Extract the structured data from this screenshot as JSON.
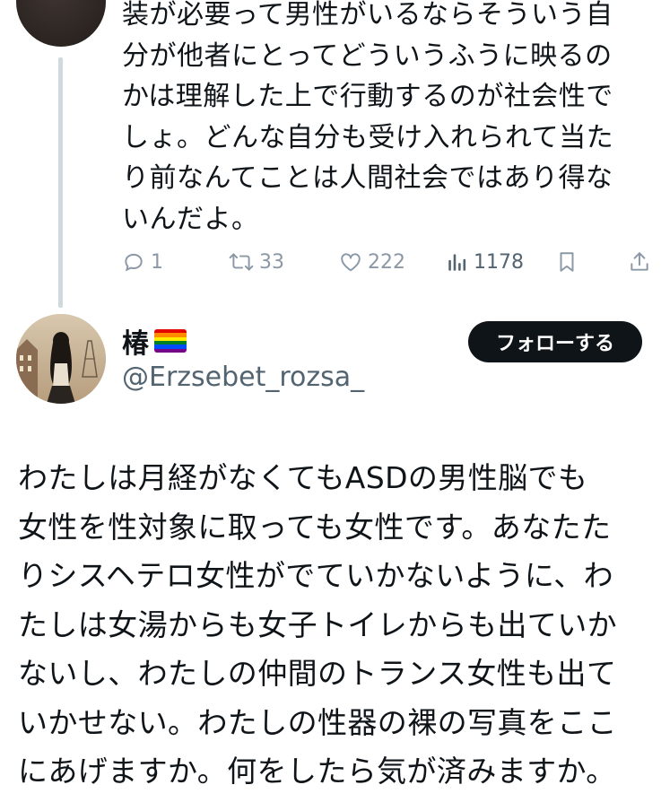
{
  "parent_tweet": {
    "lines": [
      "装が必要って男性がいるならそういう自",
      "分が他者にとってどういうふうに映るの",
      "かは理解した上で行動するのが社会性で",
      "しょ。どんな自分も受け入れられて当た",
      "り前なんてことは人間社会ではあり得な",
      "いんだよ。"
    ],
    "actions": {
      "reply_icon": "reply-icon",
      "reply_count": "1",
      "retweet_icon": "retweet-icon",
      "retweet_count": "33",
      "like_icon": "heart-icon",
      "like_count": "222",
      "views_icon": "views-icon",
      "views_count": "1178",
      "bookmark_icon": "bookmark-icon",
      "share_icon": "share-icon"
    }
  },
  "main_tweet": {
    "display_name": "椿",
    "name_emoji": "rainbow-flag",
    "handle": "@Erzsebet_rozsa_",
    "follow_label": "フォローする",
    "body_lines": [
      "わたしは月経がなくてもASDの男性脳でも",
      "女性を性対象に取っても女性です。あなたた",
      "りシスヘテロ女性がでていかないように、わ",
      "たしは女湯からも女子トイレからも出ていか",
      "ないし、わたしの仲間のトランス女性も出て",
      "いかせない。わたしの性器の裸の写真をここ",
      "にあげますか。何をしたら気が済みますか。"
    ]
  },
  "colors": {
    "text": "#0f1419",
    "secondary": "#536471",
    "icon_gray": "#8b98a5",
    "thread_line": "#cfd9de",
    "follow_bg": "#0f1419",
    "follow_text": "#ffffff"
  }
}
